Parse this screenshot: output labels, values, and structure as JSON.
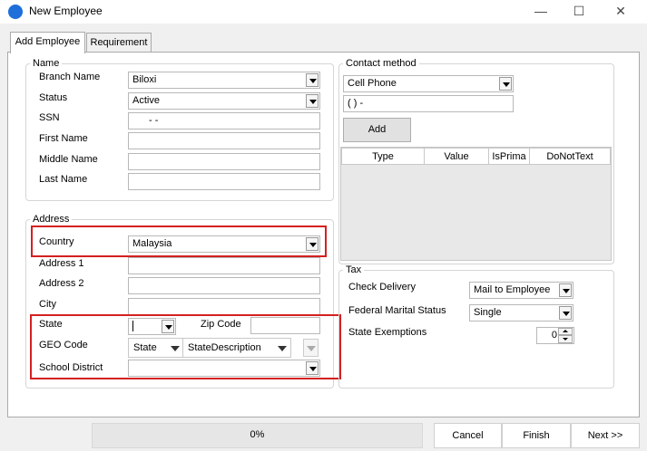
{
  "window": {
    "title": "New Employee",
    "minimize": "—",
    "maximize": "☐",
    "close": "✕"
  },
  "tabs": [
    {
      "label": "Add Employee"
    },
    {
      "label": "Requirement"
    }
  ],
  "name_group": {
    "title": "Name",
    "branch_label": "Branch Name",
    "branch_value": "Biloxi",
    "status_label": "Status",
    "status_value": "Active",
    "ssn_label": "SSN",
    "ssn_mask": "-    -",
    "first_label": "First Name",
    "first_value": "",
    "middle_label": "Middle Name",
    "middle_value": "",
    "last_label": "Last Name",
    "last_value": ""
  },
  "contact": {
    "title": "Contact method",
    "method_value": "Cell Phone",
    "phone_mask": "(       )       -",
    "add_label": "Add",
    "columns": [
      "Type",
      "Value",
      "IsPrima",
      "DoNotText"
    ]
  },
  "address": {
    "title": "Address",
    "country_label": "Country",
    "country_value": "Malaysia",
    "addr1_label": "Address 1",
    "addr2_label": "Address 2",
    "city_label": "City",
    "state_label": "State",
    "state_value": "",
    "zip_label": "Zip Code",
    "geo_label": "GEO Code",
    "geo_col_state": "State",
    "geo_col_desc": "StateDescription",
    "school_label": "School District"
  },
  "tax": {
    "title": "Tax",
    "check_label": "Check Delivery",
    "check_value": "Mail to Employee",
    "marital_label": "Federal Marital Status",
    "marital_value": "Single",
    "exemptions_label": "State Exemptions",
    "exemptions_value": "0"
  },
  "footer": {
    "progress_text": "0%",
    "progress_fraction": 0,
    "cancel": "Cancel",
    "finish": "Finish",
    "next": "Next >>"
  }
}
